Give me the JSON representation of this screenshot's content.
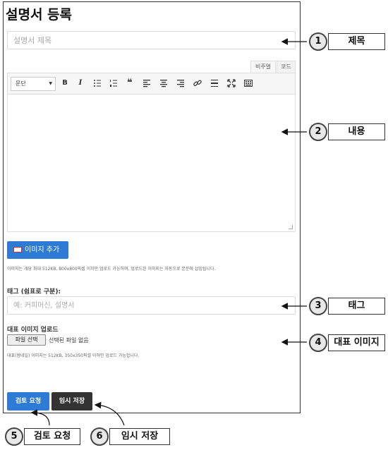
{
  "page": {
    "title": "설명서 등록",
    "title_placeholder": "설명서 제목",
    "editor_tabs": {
      "visual": "비주얼",
      "code": "코드"
    },
    "toolbar": {
      "paragraph_select": "문단",
      "buttons": [
        "bold",
        "italic",
        "bulleted-list",
        "numbered-list",
        "blockquote",
        "align-left",
        "align-center",
        "align-right",
        "link",
        "horizontal-line",
        "fullscreen",
        "toolbar-toggle"
      ],
      "bold_label": "B",
      "italic_label": "I",
      "quote_label": "❝"
    },
    "image_button": "이미지 추가",
    "image_note": "이미지는 개당 최대 512KB, 800x800픽셀 이하만 업로드 가능하며, 업로드된 이미지는 자동으로 본문에 삽입됩니다.",
    "tag_label": "태그 (쉼표로 구분):",
    "tag_placeholder": "예: 커피머신, 설명서",
    "upload_label": "대표 이미지 업로드",
    "file_button": "파일 선택",
    "file_status": "선택된 파일 없음",
    "upload_note": "대표(썸네일) 이미지는 512KB, 350x350픽셀 이하만 업로드 가능합니다.",
    "review_button": "검토 요청",
    "save_button": "임시 저장"
  },
  "callouts": [
    {
      "number": "1",
      "label": "제목"
    },
    {
      "number": "2",
      "label": "내용"
    },
    {
      "number": "3",
      "label": "태그"
    },
    {
      "number": "4",
      "label": "대표 이미지"
    },
    {
      "number": "5",
      "label": "검토 요청"
    },
    {
      "number": "6",
      "label": "임시 저장"
    }
  ],
  "colors": {
    "primary": "#2e7bd6",
    "dark_button": "#333333",
    "border": "#dddddd"
  }
}
